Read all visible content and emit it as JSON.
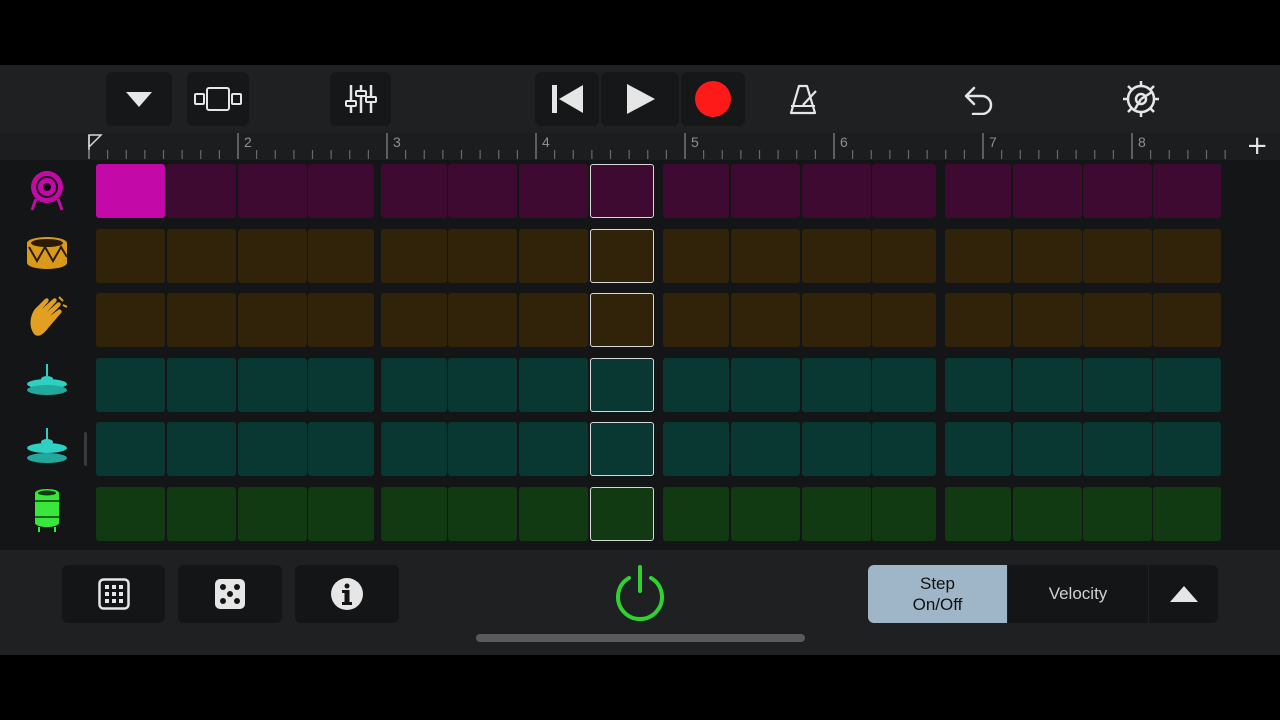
{
  "toolbar": {
    "icons": [
      "track-menu-icon",
      "view-toggle-icon",
      "mixer-icon",
      "rewind-icon",
      "play-icon",
      "record-icon",
      "metronome-icon",
      "undo-icon",
      "settings-icon"
    ]
  },
  "ruler": {
    "bar_numbers": [
      "2",
      "3",
      "4",
      "5",
      "6",
      "7",
      "8"
    ]
  },
  "tracks": [
    {
      "name": "kick-drum",
      "icon": "kick-drum-icon",
      "color": "#3e0a32",
      "active_color": "#c30aa8",
      "active_steps": [
        1
      ]
    },
    {
      "name": "snare-drum",
      "icon": "snare-drum-icon",
      "color": "#30230a",
      "active_steps": []
    },
    {
      "name": "clap",
      "icon": "clap-icon",
      "color": "#30230a",
      "active_steps": []
    },
    {
      "name": "hihat-closed",
      "icon": "hihat-closed-icon",
      "color": "#093731",
      "active_steps": []
    },
    {
      "name": "hihat-open",
      "icon": "hihat-open-icon",
      "color": "#093731",
      "active_steps": []
    },
    {
      "name": "percussion",
      "icon": "percussion-icon",
      "color": "#113a13",
      "active_steps": []
    }
  ],
  "grid": {
    "steps": 16,
    "playhead_step": 8
  },
  "bottom": {
    "icons": [
      "pattern-grid-icon",
      "randomize-dice-icon",
      "info-icon",
      "power-icon"
    ],
    "step_onoff_label": "Step\nOn/Off",
    "velocity_label": "Velocity"
  },
  "colors": {
    "record": "#ff1a1a",
    "power": "#2fd22f",
    "step_active_bg": "#9fb6c8"
  }
}
